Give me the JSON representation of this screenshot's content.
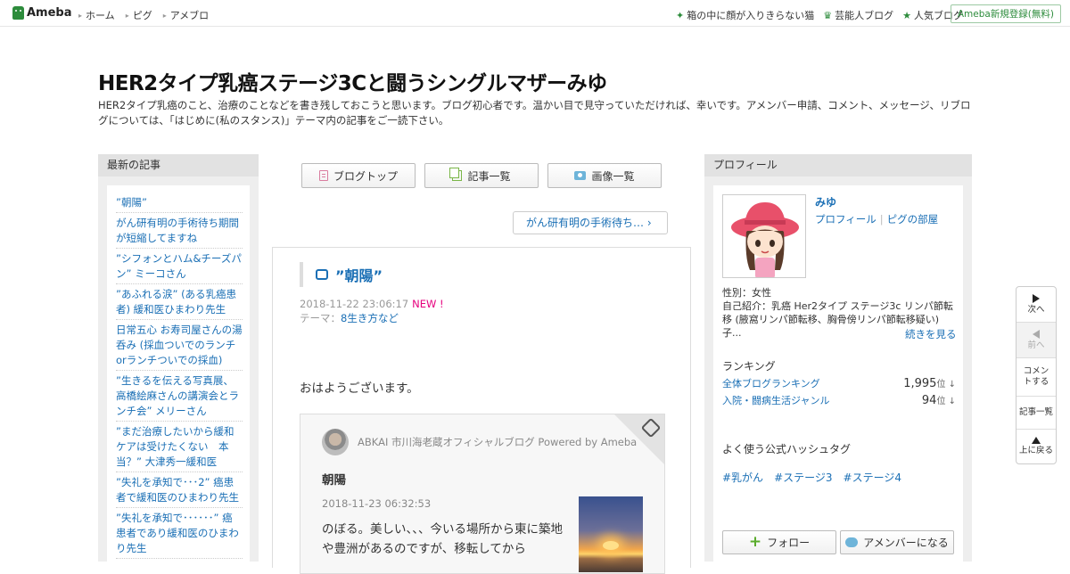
{
  "topbar": {
    "logo": "Ameba",
    "nav": [
      "ホーム",
      "ピグ",
      "アメブロ"
    ],
    "right": [
      "箱の中に顔が入りきらない猫",
      "芸能人ブログ",
      "人気ブログ"
    ],
    "signup": "Ameba新規登録(無料)"
  },
  "blog": {
    "title": "HER2タイプ乳癌ステージ3Cと闘うシングルマザーみゆ",
    "description": "HER2タイプ乳癌のこと、治療のことなどを書き残しておこうと思います。ブログ初心者です。温かい目で見守っていただければ、幸いです。アメンバー申請、コメント、メッセージ、リブログについては、「はじめに(私のスタンス)」テーマ内の記事をご一読下さい。"
  },
  "left_sidebar": {
    "heading": "最新の記事",
    "entries": [
      "”朝陽”",
      "がん研有明の手術待ち期間が短縮してますね",
      "”シフォンとハム&チーズパン” ミーコさん",
      "”あふれる涙” (ある乳癌患者) 緩和医ひまわり先生",
      "日常五心 お寿司屋さんの湯呑み (採血ついでのランチorランチついでの採血)",
      "”生きるを伝える写真展、高橋絵麻さんの講演会とランチ会” メリーさん",
      "”まだ治療したいから緩和ケアは受けたくない　本当？” 大津秀一緩和医",
      "”失礼を承知で･･･2” 癌患者で緩和医のひまわり先生",
      "”失礼を承知で･･････” 癌患者であり緩和医のひまわり先生"
    ]
  },
  "center": {
    "buttons": {
      "top": "ブログトップ",
      "list": "記事一覧",
      "images": "画像一覧"
    },
    "prev_link": "がん研有明の手術待ち…",
    "entry": {
      "title": "”朝陽”",
      "date": "2018-11-22 23:06:17",
      "new_badge": "NEW !",
      "theme_label": "テーマ：",
      "theme": "8生き方など",
      "greeting": "おはようございます。"
    },
    "reblog_card": {
      "source": "ABKAI 市川海老蔵オフィシャルブログ Powered by Ameba",
      "title": "朝陽",
      "date": "2018-11-23 06:32:53",
      "text": "のぼる。美しい、、、今いる場所から東に築地や豊洲があるのですが、移転してから"
    }
  },
  "right_sidebar": {
    "heading": "プロフィール",
    "name": "みゆ",
    "links": [
      "プロフィール",
      "ピグの部屋"
    ],
    "gender": "性別：女性",
    "intro": "自己紹介：乳癌 Her2タイプ ステージ3c リンパ節転移 (腋窩リンパ節転移、胸骨傍リンパ節転移疑い) 子...",
    "more": "続きを見る",
    "ranking_heading": "ランキング",
    "rankings": [
      {
        "label": "全体ブログランキング",
        "value": "1,995",
        "unit": "位 ↓"
      },
      {
        "label": "入院・闘病生活ジャンル",
        "value": "94",
        "unit": "位 ↓"
      }
    ],
    "hashtag_heading": "よく使う公式ハッシュタグ",
    "hashtags": [
      "#乳がん",
      "#ステージ3",
      "#ステージ4"
    ],
    "follow": "フォロー",
    "amember": "アメンバーになる"
  },
  "float_nav": {
    "next": "次へ",
    "prev": "前へ",
    "comment": "コメントする",
    "list": "記事一覧",
    "top": "上に戻る"
  }
}
